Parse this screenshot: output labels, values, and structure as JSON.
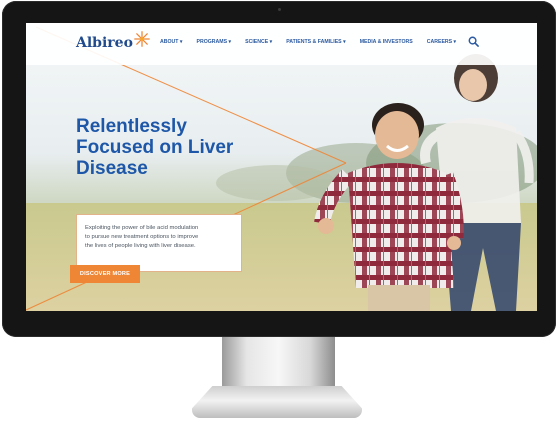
{
  "site": {
    "logo": {
      "text": "Albireo",
      "icon": "star-burst-icon"
    },
    "nav": {
      "items": [
        {
          "label": "ABOUT ▾"
        },
        {
          "label": "PROGRAMS ▾"
        },
        {
          "label": "SCIENCE ▾"
        },
        {
          "label": "PATIENTS & FAMILIES ▾"
        },
        {
          "label": "MEDIA & INVESTORS"
        },
        {
          "label": "CAREERS ▾"
        }
      ],
      "search_icon": "search-icon"
    },
    "hero": {
      "headline_lines": [
        "Relentlessly",
        "Focused on Liver",
        "Disease"
      ],
      "blurb_lines": [
        "Exploiting the power of bile acid modulation",
        "to pursue new treatment options to improve",
        "the lives of people living with liver disease."
      ],
      "cta_label": "DISCOVER MORE"
    },
    "colors": {
      "brand_blue": "#1e57a8",
      "nav_blue": "#2c5aa0",
      "accent_orange": "#ef8636"
    }
  }
}
